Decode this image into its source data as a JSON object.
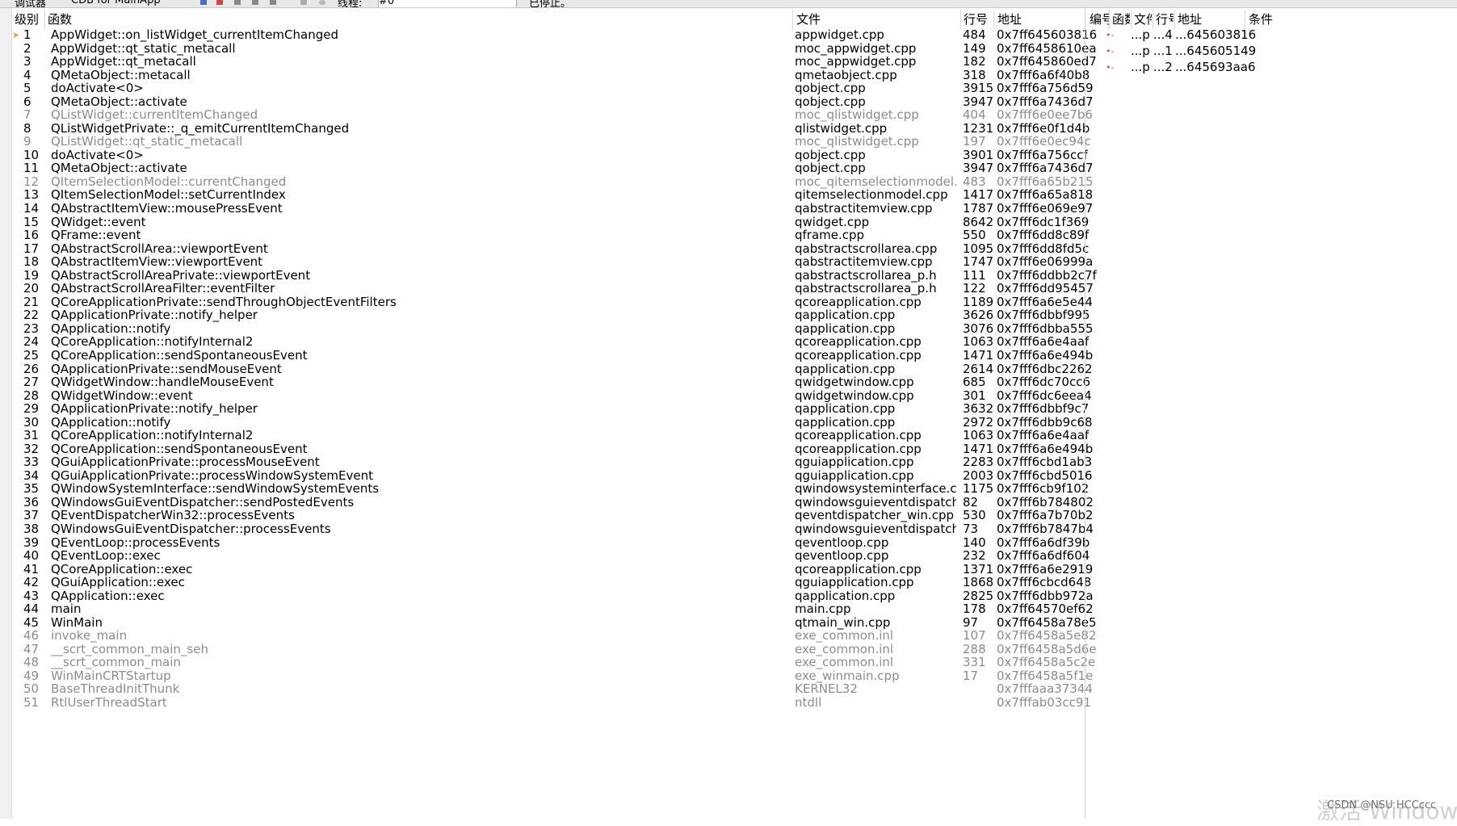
{
  "topbar": {
    "title_left": "调试器",
    "tab_title": "CDB for MainApp",
    "thread_label": "线程:",
    "thread_value": "#0",
    "status": "已停止。"
  },
  "stack": {
    "columns": {
      "level": "级别",
      "function": "函数",
      "file": "文件",
      "line": "行号",
      "address": "地址"
    },
    "rows": [
      {
        "level": "1",
        "function": "AppWidget::on_listWidget_currentItemChanged",
        "file": "appwidget.cpp",
        "line": "484",
        "address": "0x7ff645603816",
        "muted": false,
        "current": true
      },
      {
        "level": "2",
        "function": "AppWidget::qt_static_metacall",
        "file": "moc_appwidget.cpp",
        "line": "149",
        "address": "0x7ff6458610ea",
        "muted": false
      },
      {
        "level": "3",
        "function": "AppWidget::qt_metacall",
        "file": "moc_appwidget.cpp",
        "line": "182",
        "address": "0x7ff645860ed7",
        "muted": false
      },
      {
        "level": "4",
        "function": "QMetaObject::metacall",
        "file": "qmetaobject.cpp",
        "line": "318",
        "address": "0x7fff6a6f40b8",
        "muted": false
      },
      {
        "level": "5",
        "function": "doActivate<0>",
        "file": "qobject.cpp",
        "line": "3915",
        "address": "0x7fff6a756d59",
        "muted": false
      },
      {
        "level": "6",
        "function": "QMetaObject::activate",
        "file": "qobject.cpp",
        "line": "3947",
        "address": "0x7fff6a7436d7",
        "muted": false
      },
      {
        "level": "7",
        "function": "QListWidget::currentItemChanged",
        "file": "moc_qlistwidget.cpp",
        "line": "404",
        "address": "0x7fff6e0ee7b6",
        "muted": true
      },
      {
        "level": "8",
        "function": "QListWidgetPrivate::_q_emitCurrentItemChanged",
        "file": "qlistwidget.cpp",
        "line": "1231",
        "address": "0x7fff6e0f1d4b",
        "muted": false
      },
      {
        "level": "9",
        "function": "QListWidget::qt_static_metacall",
        "file": "moc_qlistwidget.cpp",
        "line": "197",
        "address": "0x7fff6e0ec94c",
        "muted": true
      },
      {
        "level": "10",
        "function": "doActivate<0>",
        "file": "qobject.cpp",
        "line": "3901",
        "address": "0x7fff6a756ccf",
        "muted": false
      },
      {
        "level": "11",
        "function": "QMetaObject::activate",
        "file": "qobject.cpp",
        "line": "3947",
        "address": "0x7fff6a7436d7",
        "muted": false
      },
      {
        "level": "12",
        "function": "QItemSelectionModel::currentChanged",
        "file": "moc_qitemselectionmodel.cpp",
        "line": "483",
        "address": "0x7fff6a65b215",
        "muted": true
      },
      {
        "level": "13",
        "function": "QItemSelectionModel::setCurrentIndex",
        "file": "qitemselectionmodel.cpp",
        "line": "1417",
        "address": "0x7fff6a65a818",
        "muted": false
      },
      {
        "level": "14",
        "function": "QAbstractItemView::mousePressEvent",
        "file": "qabstractitemview.cpp",
        "line": "1787",
        "address": "0x7fff6e069e97",
        "muted": false
      },
      {
        "level": "15",
        "function": "QWidget::event",
        "file": "qwidget.cpp",
        "line": "8642",
        "address": "0x7fff6dc1f369",
        "muted": false
      },
      {
        "level": "16",
        "function": "QFrame::event",
        "file": "qframe.cpp",
        "line": "550",
        "address": "0x7fff6dd8c89f",
        "muted": false
      },
      {
        "level": "17",
        "function": "QAbstractScrollArea::viewportEvent",
        "file": "qabstractscrollarea.cpp",
        "line": "1095",
        "address": "0x7fff6dd8fd5c",
        "muted": false
      },
      {
        "level": "18",
        "function": "QAbstractItemView::viewportEvent",
        "file": "qabstractitemview.cpp",
        "line": "1747",
        "address": "0x7fff6e06999a",
        "muted": false
      },
      {
        "level": "19",
        "function": "QAbstractScrollAreaPrivate::viewportEvent",
        "file": "qabstractscrollarea_p.h",
        "line": "111",
        "address": "0x7fff6ddbb2c7f",
        "muted": false
      },
      {
        "level": "20",
        "function": "QAbstractScrollAreaFilter::eventFilter",
        "file": "qabstractscrollarea_p.h",
        "line": "122",
        "address": "0x7fff6dd95457",
        "muted": false
      },
      {
        "level": "21",
        "function": "QCoreApplicationPrivate::sendThroughObjectEventFilters",
        "file": "qcoreapplication.cpp",
        "line": "1189",
        "address": "0x7fff6a6e5e44",
        "muted": false
      },
      {
        "level": "22",
        "function": "QApplicationPrivate::notify_helper",
        "file": "qapplication.cpp",
        "line": "3626",
        "address": "0x7fff6dbbf995",
        "muted": false
      },
      {
        "level": "23",
        "function": "QApplication::notify",
        "file": "qapplication.cpp",
        "line": "3076",
        "address": "0x7fff6dbba555",
        "muted": false
      },
      {
        "level": "24",
        "function": "QCoreApplication::notifyInternal2",
        "file": "qcoreapplication.cpp",
        "line": "1063",
        "address": "0x7fff6a6e4aaf",
        "muted": false
      },
      {
        "level": "25",
        "function": "QCoreApplication::sendSpontaneousEvent",
        "file": "qcoreapplication.cpp",
        "line": "1471",
        "address": "0x7fff6a6e494b",
        "muted": false
      },
      {
        "level": "26",
        "function": "QApplicationPrivate::sendMouseEvent",
        "file": "qapplication.cpp",
        "line": "2614",
        "address": "0x7fff6dbc2262",
        "muted": false
      },
      {
        "level": "27",
        "function": "QWidgetWindow::handleMouseEvent",
        "file": "qwidgetwindow.cpp",
        "line": "685",
        "address": "0x7fff6dc70cc6",
        "muted": false
      },
      {
        "level": "28",
        "function": "QWidgetWindow::event",
        "file": "qwidgetwindow.cpp",
        "line": "301",
        "address": "0x7fff6dc6eea4",
        "muted": false
      },
      {
        "level": "29",
        "function": "QApplicationPrivate::notify_helper",
        "file": "qapplication.cpp",
        "line": "3632",
        "address": "0x7fff6dbbf9c7",
        "muted": false
      },
      {
        "level": "30",
        "function": "QApplication::notify",
        "file": "qapplication.cpp",
        "line": "2972",
        "address": "0x7fff6dbb9c68",
        "muted": false
      },
      {
        "level": "31",
        "function": "QCoreApplication::notifyInternal2",
        "file": "qcoreapplication.cpp",
        "line": "1063",
        "address": "0x7fff6a6e4aaf",
        "muted": false
      },
      {
        "level": "32",
        "function": "QCoreApplication::sendSpontaneousEvent",
        "file": "qcoreapplication.cpp",
        "line": "1471",
        "address": "0x7fff6a6e494b",
        "muted": false
      },
      {
        "level": "33",
        "function": "QGuiApplicationPrivate::processMouseEvent",
        "file": "qguiapplication.cpp",
        "line": "2283",
        "address": "0x7fff6cbd1ab3",
        "muted": false
      },
      {
        "level": "34",
        "function": "QGuiApplicationPrivate::processWindowSystemEvent",
        "file": "qguiapplication.cpp",
        "line": "2003",
        "address": "0x7fff6cbd5016",
        "muted": false
      },
      {
        "level": "35",
        "function": "QWindowSystemInterface::sendWindowSystemEvents",
        "file": "qwindowsysteminterface.cpp",
        "line": "1175",
        "address": "0x7fff6cb9f102",
        "muted": false
      },
      {
        "level": "36",
        "function": "QWindowsGuiEventDispatcher::sendPostedEvents",
        "file": "qwindowsguieventdispatcher....",
        "line": "82",
        "address": "0x7fff6b784802",
        "muted": false
      },
      {
        "level": "37",
        "function": "QEventDispatcherWin32::processEvents",
        "file": "qeventdispatcher_win.cpp",
        "line": "530",
        "address": "0x7fff6a7b70b2",
        "muted": false
      },
      {
        "level": "38",
        "function": "QWindowsGuiEventDispatcher::processEvents",
        "file": "qwindowsguieventdispatcher....",
        "line": "73",
        "address": "0x7fff6b7847b4",
        "muted": false
      },
      {
        "level": "39",
        "function": "QEventLoop::processEvents",
        "file": "qeventloop.cpp",
        "line": "140",
        "address": "0x7fff6a6df39b",
        "muted": false
      },
      {
        "level": "40",
        "function": "QEventLoop::exec",
        "file": "qeventloop.cpp",
        "line": "232",
        "address": "0x7fff6a6df604",
        "muted": false
      },
      {
        "level": "41",
        "function": "QCoreApplication::exec",
        "file": "qcoreapplication.cpp",
        "line": "1371",
        "address": "0x7fff6a6e2919",
        "muted": false
      },
      {
        "level": "42",
        "function": "QGuiApplication::exec",
        "file": "qguiapplication.cpp",
        "line": "1868",
        "address": "0x7fff6cbcd648",
        "muted": false
      },
      {
        "level": "43",
        "function": "QApplication::exec",
        "file": "qapplication.cpp",
        "line": "2825",
        "address": "0x7fff6dbb972a",
        "muted": false
      },
      {
        "level": "44",
        "function": "main",
        "file": "main.cpp",
        "line": "178",
        "address": "0x7ff64570ef62",
        "muted": false
      },
      {
        "level": "45",
        "function": "WinMain",
        "file": "qtmain_win.cpp",
        "line": "97",
        "address": "0x7ff6458a78e5",
        "muted": false
      },
      {
        "level": "46",
        "function": "invoke_main",
        "file": "exe_common.inl",
        "line": "107",
        "address": "0x7ff6458a5e82",
        "muted": true
      },
      {
        "level": "47",
        "function": "__scrt_common_main_seh",
        "file": "exe_common.inl",
        "line": "288",
        "address": "0x7ff6458a5d6e",
        "muted": true
      },
      {
        "level": "48",
        "function": "__scrt_common_main",
        "file": "exe_common.inl",
        "line": "331",
        "address": "0x7ff6458a5c2e",
        "muted": true
      },
      {
        "level": "49",
        "function": "WinMainCRTStartup",
        "file": "exe_winmain.cpp",
        "line": "17",
        "address": "0x7ff6458a5f1e",
        "muted": true
      },
      {
        "level": "50",
        "function": "BaseThreadInitThunk",
        "file": "KERNEL32",
        "line": "",
        "address": "0x7fffaaa37344",
        "muted": true
      },
      {
        "level": "51",
        "function": "RtlUserThreadStart",
        "file": "ntdll",
        "line": "",
        "address": "0x7fffab03cc91",
        "muted": true
      }
    ]
  },
  "breakpoints": {
    "columns": {
      "number": "编号",
      "function": "函数",
      "file": "文件",
      "line": "行号",
      "address": "地址",
      "condition": "条件"
    },
    "rows": [
      {
        "function": "...p",
        "line": "...4",
        "address": "...645603816"
      },
      {
        "function": "...p",
        "line": "...1",
        "address": "...645605149"
      },
      {
        "function": "...p",
        "line": "...2",
        "address": "...645693aa6"
      }
    ]
  },
  "overlay": {
    "watermark": "激活 Windows",
    "credit": "CSDN @NSU HCCccc"
  },
  "colors": {
    "muted_text": "#8c8c8c",
    "current_arrow": "#d9a23a",
    "breakpoint_marker": "#d05050"
  }
}
